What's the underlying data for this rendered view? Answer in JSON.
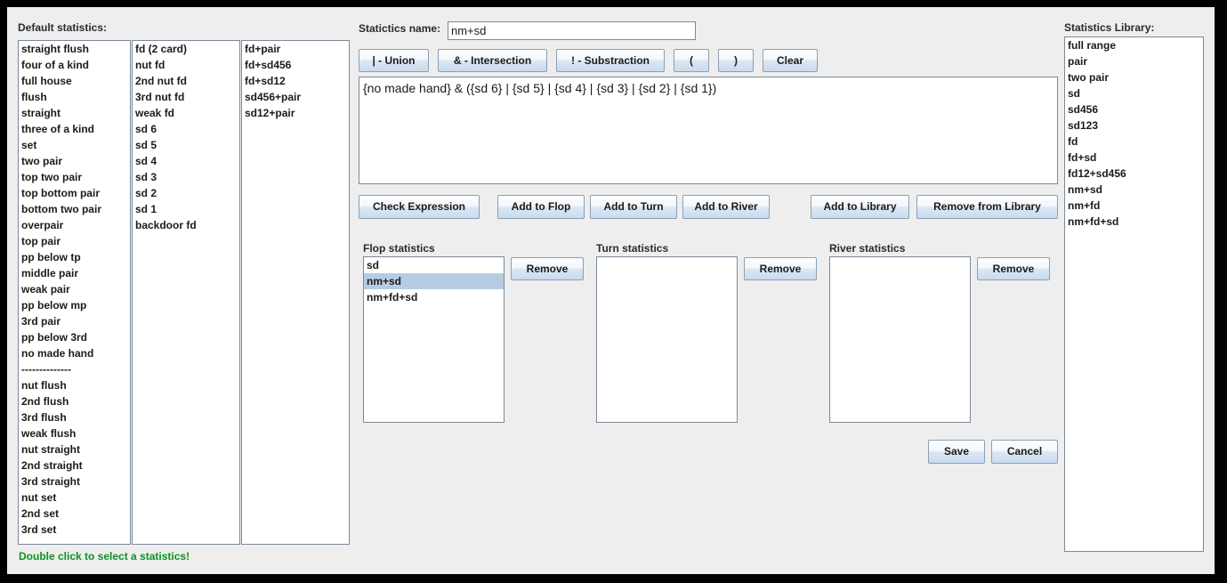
{
  "default_statistics": {
    "label": "Default statistics:",
    "column1": [
      "straight flush",
      "four of a kind",
      "full house",
      "flush",
      "straight",
      "three of a kind",
      "set",
      "two pair",
      "top two pair",
      "top bottom pair",
      "bottom two pair",
      "overpair",
      "top pair",
      "pp below tp",
      "middle pair",
      "weak pair",
      "pp below mp",
      "3rd pair",
      "pp below 3rd",
      "no made hand",
      "--------------",
      "nut flush",
      "2nd flush",
      "3rd flush",
      "weak flush",
      "nut straight",
      "2nd straight",
      "3rd straight",
      "nut set",
      "2nd set",
      "3rd set"
    ],
    "column2": [
      "fd (2 card)",
      "nut fd",
      "2nd nut fd",
      "3rd nut fd",
      "weak fd",
      "sd 6",
      "sd 5",
      "sd 4",
      "sd 3",
      "sd 2",
      "sd 1",
      "backdoor fd"
    ],
    "column3": [
      "fd+pair",
      "fd+sd456",
      "fd+sd12",
      "sd456+pair",
      "sd12+pair"
    ]
  },
  "statistics_name": {
    "label": "Statictics name:",
    "value": "nm+sd",
    "placeholder": ""
  },
  "operator_buttons": [
    {
      "label": "| - Union"
    },
    {
      "label": "& - Intersection"
    },
    {
      "label": "! - Substraction"
    },
    {
      "label": "("
    },
    {
      "label": ")"
    },
    {
      "label": "Clear"
    }
  ],
  "expression": {
    "value": "{no made hand} & ({sd 6} | {sd 5} | {sd 4} | {sd 3} | {sd 2} | {sd 1})",
    "placeholder": ""
  },
  "action_buttons": {
    "check_expression": "Check Expression",
    "add_to_flop": "Add to Flop",
    "add_to_turn": "Add to Turn",
    "add_to_river": "Add to River",
    "add_to_library": "Add to Library",
    "remove_from_library": "Remove from Library"
  },
  "street_panels": {
    "flop": {
      "title": "Flop statistics",
      "items": [
        "sd",
        "nm+sd",
        "nm+fd+sd"
      ],
      "selected_index": 1,
      "remove_label": "Remove"
    },
    "turn": {
      "title": "Turn statistics",
      "items": [],
      "selected_index": -1,
      "remove_label": "Remove"
    },
    "river": {
      "title": "River statistics",
      "items": [],
      "selected_index": -1,
      "remove_label": "Remove"
    }
  },
  "dialog_buttons": {
    "save": "Save",
    "cancel": "Cancel"
  },
  "statistics_library": {
    "label": "Statistics Library:",
    "items": [
      "full range",
      "pair",
      "two pair",
      "sd",
      "sd456",
      "sd123",
      "fd",
      "fd+sd",
      "fd12+sd456",
      "nm+sd",
      "nm+fd",
      "nm+fd+sd"
    ]
  },
  "status_message": "Double click to select a statistics!",
  "colors": {
    "window_background": "#eeeeee",
    "border": "#000000",
    "list_border": "#7a8a99",
    "selection": "#b5cde4",
    "status_text": "#0f9124",
    "text": "#1b1b1b"
  }
}
